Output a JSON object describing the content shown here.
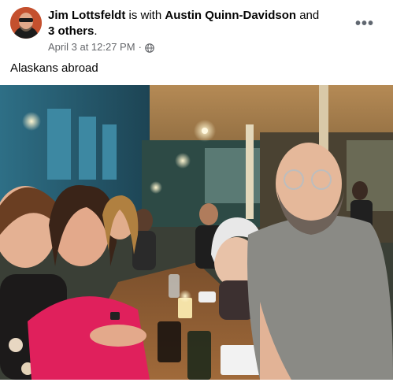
{
  "post": {
    "author": "Jim Lottsfeldt",
    "with_text": " is with ",
    "tagged_person": "Austin Quinn-Davidson",
    "and_text": " and",
    "others_link": "3 others",
    "period": ".",
    "date": "April 3 at 12:27 PM",
    "separator": "·",
    "privacy_icon": "globe-icon",
    "more_icon": "more-options-icon",
    "more_label": "•••",
    "caption": "Alaskans abroad",
    "photo_description_icon": "group-photo"
  }
}
